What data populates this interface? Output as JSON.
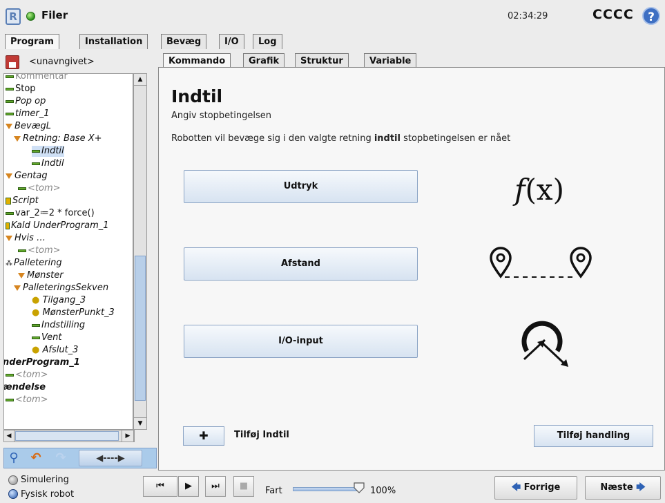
{
  "window": {
    "title": "Filer",
    "time": "02:34:29",
    "robot_name": "CCCC",
    "help_glyph": "?",
    "logo_glyph": "R"
  },
  "top_tabs": [
    {
      "label": "Program",
      "active": true
    },
    {
      "label": "Installation",
      "active": false
    },
    {
      "label": "Bevæg",
      "active": false
    },
    {
      "label": "I/O",
      "active": false
    },
    {
      "label": "Log",
      "active": false
    }
  ],
  "program": {
    "name": "<unavngivet>"
  },
  "tree": [
    "Kommentar",
    "Stop",
    "Pop op",
    "timer_1",
    "BevægL",
    "Retning: Base X+",
    "Indtil",
    "Indtil",
    "Gentag",
    "<tom>",
    "Script",
    "var_2≔2 * force()",
    "Kald UnderProgram_1",
    "Hvis …",
    "<tom>",
    "Palletering",
    "Mønster",
    "PalleteringsSekven",
    "Tilgang_3",
    "MønsterPunkt_3",
    "Indstilling",
    "Vent",
    "Afslut_3",
    "nderProgram_1",
    "<tom>",
    "ændelse",
    "<tom>"
  ],
  "sub_tabs": [
    {
      "label": "Kommando",
      "active": true
    },
    {
      "label": "Grafik",
      "active": false
    },
    {
      "label": "Struktur",
      "active": false
    },
    {
      "label": "Variable",
      "active": false
    }
  ],
  "main": {
    "heading": "Indtil",
    "subtitle": "Angiv stopbetingelsen",
    "description_pre": "Robotten vil bevæge sig i den valgte retning ",
    "description_bold": "indtil",
    "description_post": " stopbetingelsen er nået",
    "options": [
      {
        "label": "Udtryk",
        "icon": "function-icon"
      },
      {
        "label": "Afstand",
        "icon": "distance-icon"
      },
      {
        "label": "I/O-input",
        "icon": "io-input-icon"
      }
    ],
    "fx_f": "f",
    "fx_rest": "(x)",
    "add_until_label": "Tilføj Indtil",
    "add_action_label": "Tilføj handling"
  },
  "footer": {
    "simulation_label": "Simulering",
    "real_robot_label": "Fysisk robot",
    "speed_label": "Fart",
    "speed_value": "100%",
    "speed_fraction": 1.0,
    "prev_label": "Forrige",
    "next_label": "Næste"
  },
  "colors": {
    "accent": "#3e6fc3",
    "selection": "#cfe0f5",
    "node_green": "#62a82c",
    "node_orange": "#d68520"
  }
}
